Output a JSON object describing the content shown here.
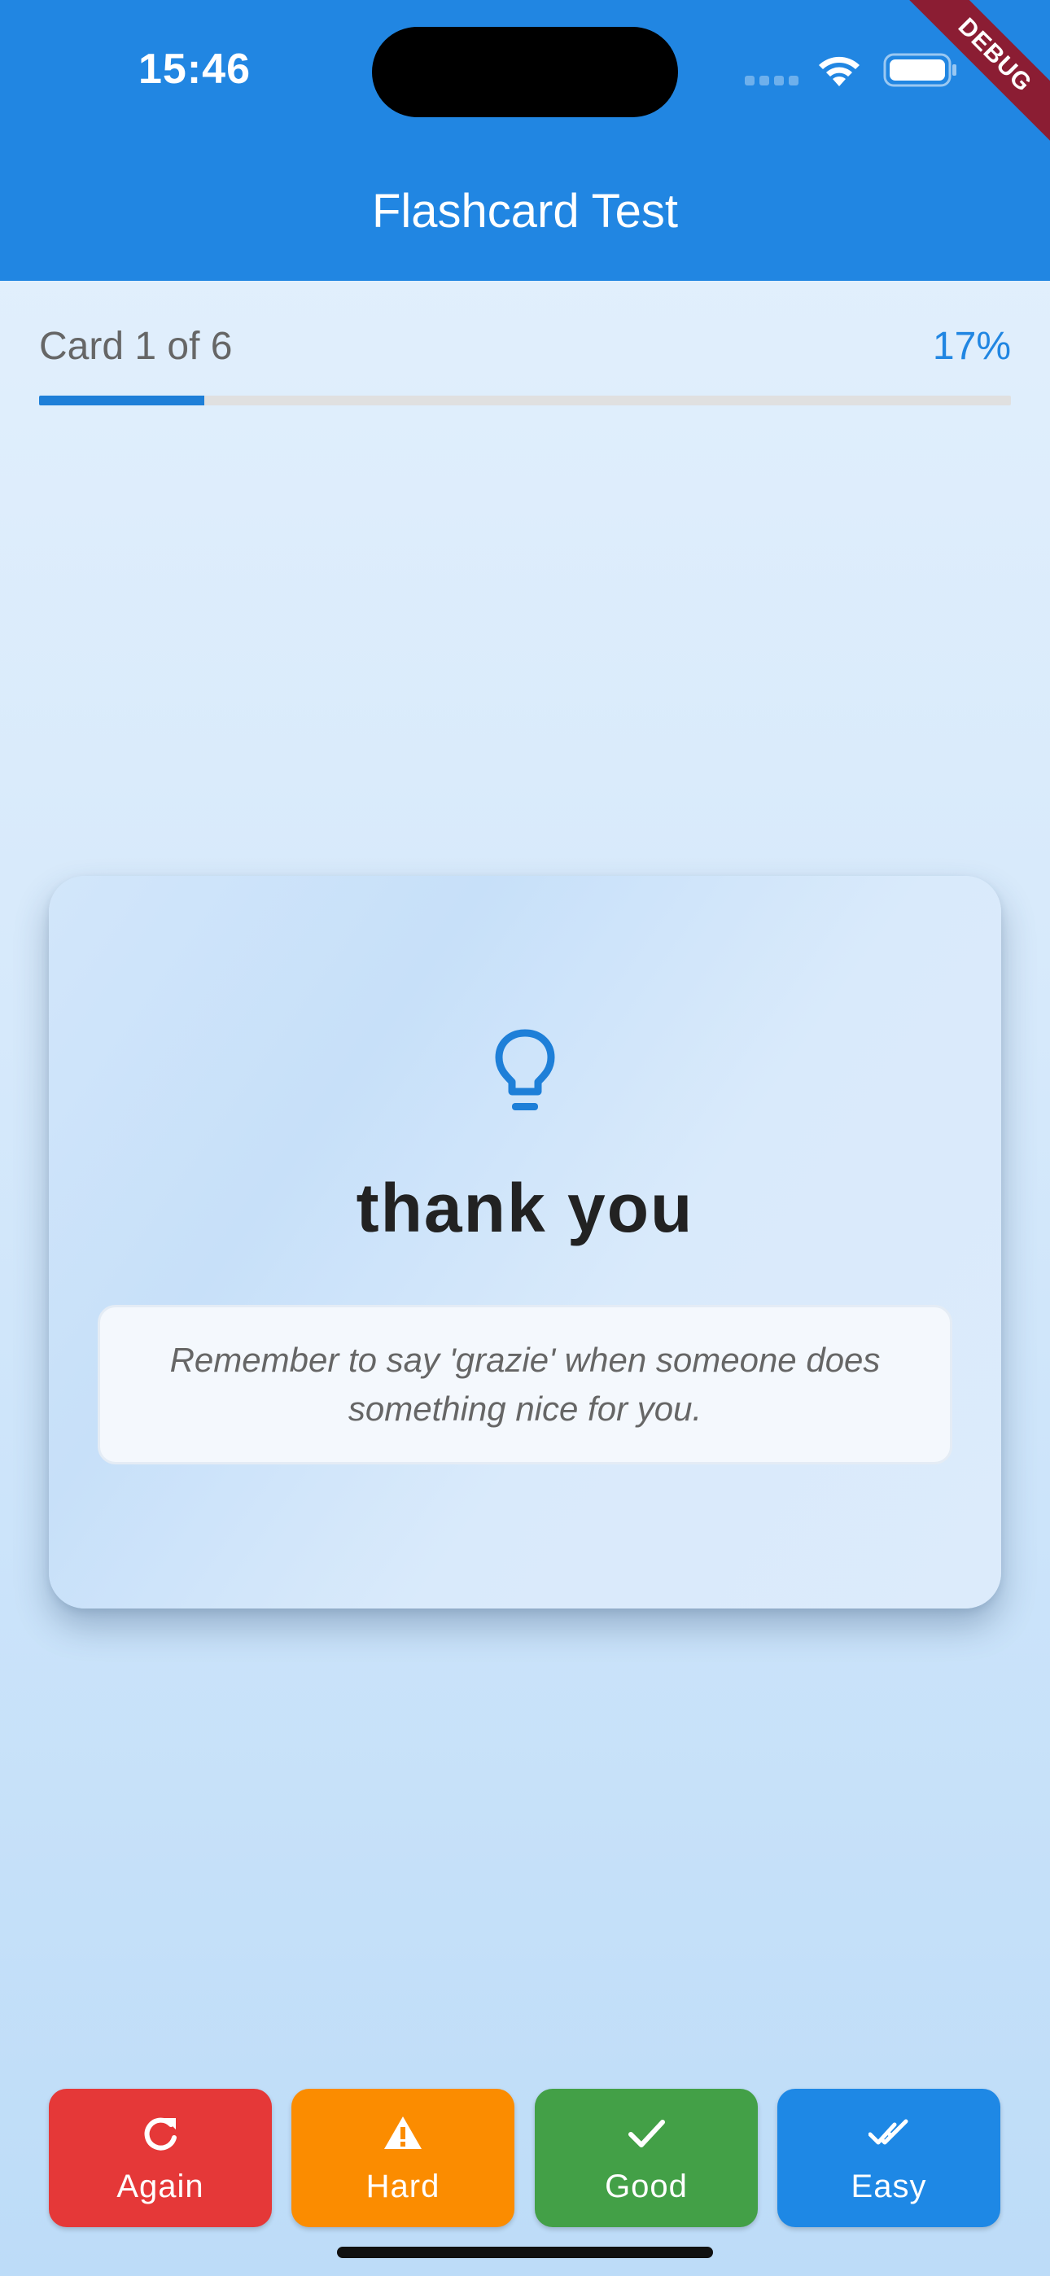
{
  "status_bar": {
    "time": "15:46"
  },
  "app_bar": {
    "title": "Flashcard Test",
    "debug_banner": "DEBUG"
  },
  "progress": {
    "counter_text": "Card 1 of 6",
    "percent_text": "17%",
    "fraction": 0.17
  },
  "card": {
    "icon": "lightbulb-icon",
    "word": "thank you",
    "hint": "Remember to say 'grazie' when someone does something nice for you."
  },
  "buttons": {
    "again": {
      "label": "Again",
      "icon": "refresh-icon",
      "color": "#e53838"
    },
    "hard": {
      "label": "Hard",
      "icon": "warning-icon",
      "color": "#fb8c00"
    },
    "good": {
      "label": "Good",
      "icon": "check-icon",
      "color": "#43a047"
    },
    "easy": {
      "label": "Easy",
      "icon": "double-check-icon",
      "color": "#1e88e5"
    }
  },
  "colors": {
    "primary": "#2186e2",
    "text_dark": "#222222"
  }
}
